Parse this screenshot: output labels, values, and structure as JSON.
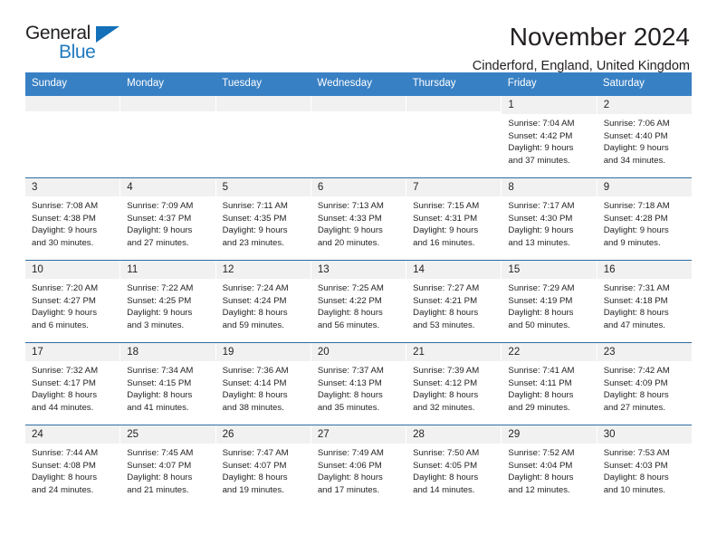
{
  "logo": {
    "word_one": "General",
    "word_two": "Blue",
    "triangle_color": "#1470b8"
  },
  "header": {
    "title": "November 2024",
    "subtitle": "Cinderford, England, United Kingdom"
  },
  "theme": {
    "header_blue": "#3880c4",
    "row_rule_blue": "#2e6da4",
    "day_strip_gray": "#f1f1f1",
    "text": "#231f20"
  },
  "weekdays": [
    "Sunday",
    "Monday",
    "Tuesday",
    "Wednesday",
    "Thursday",
    "Friday",
    "Saturday"
  ],
  "weeks": [
    [
      {
        "day": "",
        "empty": true
      },
      {
        "day": "",
        "empty": true
      },
      {
        "day": "",
        "empty": true
      },
      {
        "day": "",
        "empty": true
      },
      {
        "day": "",
        "empty": true
      },
      {
        "day": "1",
        "sunrise": "Sunrise: 7:04 AM",
        "sunset": "Sunset: 4:42 PM",
        "daylight1": "Daylight: 9 hours",
        "daylight2": "and 37 minutes."
      },
      {
        "day": "2",
        "sunrise": "Sunrise: 7:06 AM",
        "sunset": "Sunset: 4:40 PM",
        "daylight1": "Daylight: 9 hours",
        "daylight2": "and 34 minutes."
      }
    ],
    [
      {
        "day": "3",
        "sunrise": "Sunrise: 7:08 AM",
        "sunset": "Sunset: 4:38 PM",
        "daylight1": "Daylight: 9 hours",
        "daylight2": "and 30 minutes."
      },
      {
        "day": "4",
        "sunrise": "Sunrise: 7:09 AM",
        "sunset": "Sunset: 4:37 PM",
        "daylight1": "Daylight: 9 hours",
        "daylight2": "and 27 minutes."
      },
      {
        "day": "5",
        "sunrise": "Sunrise: 7:11 AM",
        "sunset": "Sunset: 4:35 PM",
        "daylight1": "Daylight: 9 hours",
        "daylight2": "and 23 minutes."
      },
      {
        "day": "6",
        "sunrise": "Sunrise: 7:13 AM",
        "sunset": "Sunset: 4:33 PM",
        "daylight1": "Daylight: 9 hours",
        "daylight2": "and 20 minutes."
      },
      {
        "day": "7",
        "sunrise": "Sunrise: 7:15 AM",
        "sunset": "Sunset: 4:31 PM",
        "daylight1": "Daylight: 9 hours",
        "daylight2": "and 16 minutes."
      },
      {
        "day": "8",
        "sunrise": "Sunrise: 7:17 AM",
        "sunset": "Sunset: 4:30 PM",
        "daylight1": "Daylight: 9 hours",
        "daylight2": "and 13 minutes."
      },
      {
        "day": "9",
        "sunrise": "Sunrise: 7:18 AM",
        "sunset": "Sunset: 4:28 PM",
        "daylight1": "Daylight: 9 hours",
        "daylight2": "and 9 minutes."
      }
    ],
    [
      {
        "day": "10",
        "sunrise": "Sunrise: 7:20 AM",
        "sunset": "Sunset: 4:27 PM",
        "daylight1": "Daylight: 9 hours",
        "daylight2": "and 6 minutes."
      },
      {
        "day": "11",
        "sunrise": "Sunrise: 7:22 AM",
        "sunset": "Sunset: 4:25 PM",
        "daylight1": "Daylight: 9 hours",
        "daylight2": "and 3 minutes."
      },
      {
        "day": "12",
        "sunrise": "Sunrise: 7:24 AM",
        "sunset": "Sunset: 4:24 PM",
        "daylight1": "Daylight: 8 hours",
        "daylight2": "and 59 minutes."
      },
      {
        "day": "13",
        "sunrise": "Sunrise: 7:25 AM",
        "sunset": "Sunset: 4:22 PM",
        "daylight1": "Daylight: 8 hours",
        "daylight2": "and 56 minutes."
      },
      {
        "day": "14",
        "sunrise": "Sunrise: 7:27 AM",
        "sunset": "Sunset: 4:21 PM",
        "daylight1": "Daylight: 8 hours",
        "daylight2": "and 53 minutes."
      },
      {
        "day": "15",
        "sunrise": "Sunrise: 7:29 AM",
        "sunset": "Sunset: 4:19 PM",
        "daylight1": "Daylight: 8 hours",
        "daylight2": "and 50 minutes."
      },
      {
        "day": "16",
        "sunrise": "Sunrise: 7:31 AM",
        "sunset": "Sunset: 4:18 PM",
        "daylight1": "Daylight: 8 hours",
        "daylight2": "and 47 minutes."
      }
    ],
    [
      {
        "day": "17",
        "sunrise": "Sunrise: 7:32 AM",
        "sunset": "Sunset: 4:17 PM",
        "daylight1": "Daylight: 8 hours",
        "daylight2": "and 44 minutes."
      },
      {
        "day": "18",
        "sunrise": "Sunrise: 7:34 AM",
        "sunset": "Sunset: 4:15 PM",
        "daylight1": "Daylight: 8 hours",
        "daylight2": "and 41 minutes."
      },
      {
        "day": "19",
        "sunrise": "Sunrise: 7:36 AM",
        "sunset": "Sunset: 4:14 PM",
        "daylight1": "Daylight: 8 hours",
        "daylight2": "and 38 minutes."
      },
      {
        "day": "20",
        "sunrise": "Sunrise: 7:37 AM",
        "sunset": "Sunset: 4:13 PM",
        "daylight1": "Daylight: 8 hours",
        "daylight2": "and 35 minutes."
      },
      {
        "day": "21",
        "sunrise": "Sunrise: 7:39 AM",
        "sunset": "Sunset: 4:12 PM",
        "daylight1": "Daylight: 8 hours",
        "daylight2": "and 32 minutes."
      },
      {
        "day": "22",
        "sunrise": "Sunrise: 7:41 AM",
        "sunset": "Sunset: 4:11 PM",
        "daylight1": "Daylight: 8 hours",
        "daylight2": "and 29 minutes."
      },
      {
        "day": "23",
        "sunrise": "Sunrise: 7:42 AM",
        "sunset": "Sunset: 4:09 PM",
        "daylight1": "Daylight: 8 hours",
        "daylight2": "and 27 minutes."
      }
    ],
    [
      {
        "day": "24",
        "sunrise": "Sunrise: 7:44 AM",
        "sunset": "Sunset: 4:08 PM",
        "daylight1": "Daylight: 8 hours",
        "daylight2": "and 24 minutes."
      },
      {
        "day": "25",
        "sunrise": "Sunrise: 7:45 AM",
        "sunset": "Sunset: 4:07 PM",
        "daylight1": "Daylight: 8 hours",
        "daylight2": "and 21 minutes."
      },
      {
        "day": "26",
        "sunrise": "Sunrise: 7:47 AM",
        "sunset": "Sunset: 4:07 PM",
        "daylight1": "Daylight: 8 hours",
        "daylight2": "and 19 minutes."
      },
      {
        "day": "27",
        "sunrise": "Sunrise: 7:49 AM",
        "sunset": "Sunset: 4:06 PM",
        "daylight1": "Daylight: 8 hours",
        "daylight2": "and 17 minutes."
      },
      {
        "day": "28",
        "sunrise": "Sunrise: 7:50 AM",
        "sunset": "Sunset: 4:05 PM",
        "daylight1": "Daylight: 8 hours",
        "daylight2": "and 14 minutes."
      },
      {
        "day": "29",
        "sunrise": "Sunrise: 7:52 AM",
        "sunset": "Sunset: 4:04 PM",
        "daylight1": "Daylight: 8 hours",
        "daylight2": "and 12 minutes."
      },
      {
        "day": "30",
        "sunrise": "Sunrise: 7:53 AM",
        "sunset": "Sunset: 4:03 PM",
        "daylight1": "Daylight: 8 hours",
        "daylight2": "and 10 minutes."
      }
    ]
  ]
}
